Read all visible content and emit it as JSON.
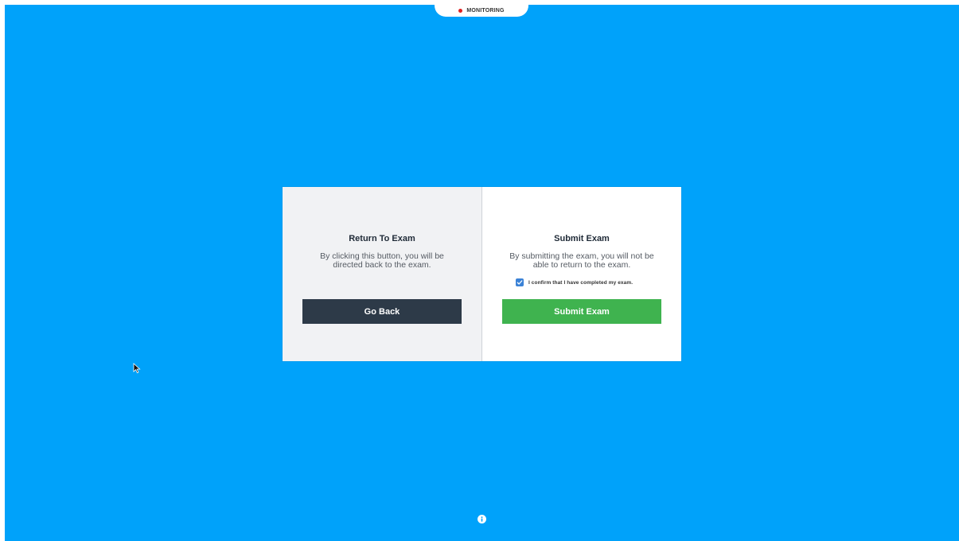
{
  "monitoring": {
    "label": "MONITORING",
    "indicator_color": "#e02020"
  },
  "return_panel": {
    "title": "Return To Exam",
    "description": "By clicking this button, you will be directed back to the exam.",
    "button_label": "Go Back"
  },
  "submit_panel": {
    "title": "Submit Exam",
    "description": "By submitting the exam, you will not be able to return to the exam.",
    "confirm_label": "I confirm that I have completed my exam.",
    "confirm_checked": true,
    "button_label": "Submit Exam"
  },
  "colors": {
    "background": "#00a2fa",
    "go_back_button": "#2d3a48",
    "submit_button": "#3fb34f",
    "checkbox": "#3b82d6"
  },
  "icons": {
    "cursor": "mouse-pointer-icon",
    "info": "info-icon",
    "check": "check-icon"
  }
}
